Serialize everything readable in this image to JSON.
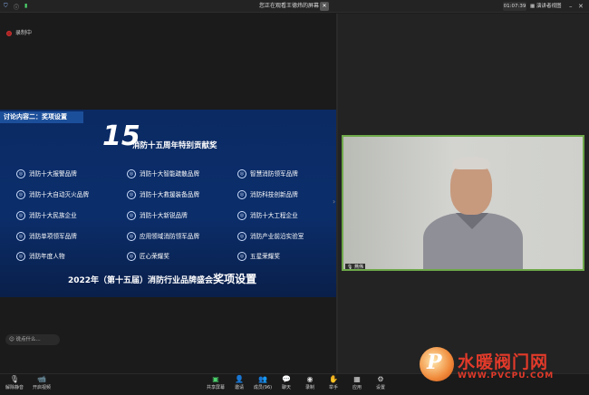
{
  "window": {
    "title": "您正在观看王德炜的屏幕",
    "timer": "01:07:39",
    "view_label": "演讲者视图"
  },
  "recording": {
    "label": "录制中"
  },
  "slide": {
    "tag": "讨论内容二：奖项设置",
    "number": "15",
    "heading": "消防十五周年特别贡献奖",
    "awards": [
      [
        "消防十大报警品牌",
        "消防十大智能疏散品牌",
        "智慧消防领军品牌"
      ],
      [
        "消防十大自动灭火品牌",
        "消防十大救援装备品牌",
        "消防科技创新品牌"
      ],
      [
        "消防十大民族企业",
        "消防十大新锐品牌",
        "消防十大工程企业"
      ],
      [
        "消防单项领军品牌",
        "应用领域消防领军品牌",
        "消防产业前沿实验室"
      ],
      [
        "消防年度人物",
        "匠心荣耀奖",
        "五星荣耀奖"
      ]
    ],
    "footer_prefix": "2022年（第十五届）消防行业品牌盛会",
    "footer_big": "奖项设置"
  },
  "participant": {
    "name": "燕伟"
  },
  "chat_input": {
    "placeholder": "说点什么..."
  },
  "toolbar": {
    "left": [
      {
        "name": "unmute",
        "label": "解除静音",
        "icon": "mic-muted-icon"
      },
      {
        "name": "start-video",
        "label": "开启视频",
        "icon": "video-off-icon"
      }
    ],
    "center": [
      {
        "name": "share-screen",
        "label": "共享屏幕",
        "icon": "share-screen-icon"
      },
      {
        "name": "invite",
        "label": "邀请",
        "icon": "invite-icon"
      },
      {
        "name": "members",
        "label": "成员(96)",
        "icon": "members-icon"
      },
      {
        "name": "chat",
        "label": "聊天",
        "icon": "chat-icon"
      },
      {
        "name": "record",
        "label": "录制",
        "icon": "record-icon"
      },
      {
        "name": "raise-hand",
        "label": "举手",
        "icon": "hand-icon"
      },
      {
        "name": "apps",
        "label": "应用",
        "icon": "apps-icon"
      },
      {
        "name": "settings",
        "label": "设置",
        "icon": "gear-icon"
      }
    ]
  },
  "watermark": {
    "logo_letter": "P",
    "text": "水暖阀门网",
    "url": "WWW.PVCPU.COM"
  },
  "colors": {
    "slide_bg": "#0b2e6b",
    "speaker_border": "#6ea84a",
    "watermark_red": "#e23a2a",
    "share_green": "#4bd16b"
  }
}
